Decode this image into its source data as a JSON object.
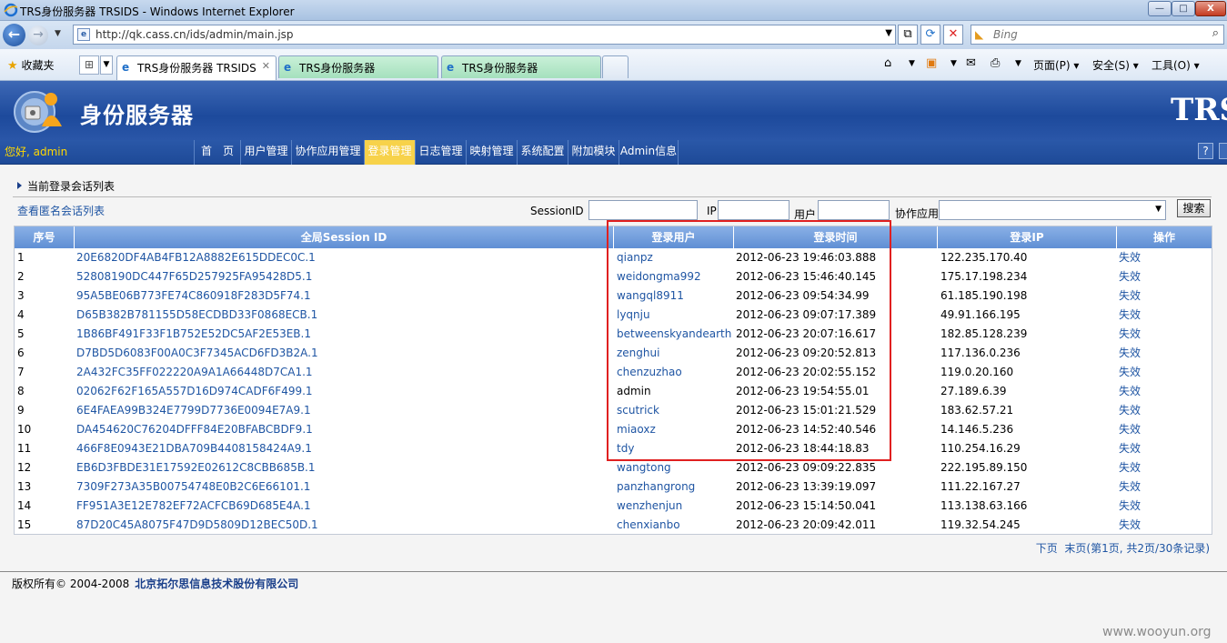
{
  "window": {
    "title": "TRS身份服务器 TRSIDS - Windows Internet Explorer",
    "buttons": {
      "minimize": "—",
      "maximize": "□",
      "close": "X"
    }
  },
  "address_bar": {
    "url": "http://qk.cass.cn/ids/admin/main.jsp",
    "search_placeholder": "Bing"
  },
  "favorites": {
    "label": "收藏夹",
    "tabs": [
      {
        "label": "TRS身份服务器 TRSIDS",
        "active": true
      },
      {
        "label": "TRS身份服务器",
        "active": false
      },
      {
        "label": "TRS身份服务器",
        "active": false
      }
    ],
    "commands": {
      "page": "页面(P)",
      "safety": "安全(S)",
      "tools": "工具(O)"
    }
  },
  "app": {
    "title": "身份服务器",
    "brand": "TRS",
    "greeting": "您好, admin",
    "menu": [
      {
        "label": "首　页"
      },
      {
        "label": "用户管理"
      },
      {
        "label": "协作应用管理"
      },
      {
        "label": "登录管理",
        "active": true
      },
      {
        "label": "日志管理"
      },
      {
        "label": "映射管理"
      },
      {
        "label": "系统配置"
      },
      {
        "label": "附加模块"
      },
      {
        "label": "Admin信息"
      }
    ],
    "help": "?"
  },
  "page": {
    "section_title": "当前登录会话列表",
    "anon_link": "查看匿名会话列表",
    "filters": {
      "session_label": "SessionID",
      "ip_label": "IP",
      "user_label": "用户",
      "app_label": "协作应用",
      "search_button": "搜索"
    },
    "table": {
      "headers": [
        "序号",
        "全局Session ID",
        "登录用户",
        "登录时间",
        "登录IP",
        "操作"
      ],
      "rows": [
        {
          "no": "1",
          "sid": "20E6820DF4AB4FB12A8882E615DDEC0C.1",
          "user": "qianpz",
          "time": "2012-06-23 19:46:03.888",
          "ip": "122.235.170.40",
          "op": "失效",
          "user_link": true
        },
        {
          "no": "2",
          "sid": "52808190DC447F65D257925FA95428D5.1",
          "user": "weidongma992",
          "time": "2012-06-23 15:46:40.145",
          "ip": "175.17.198.234",
          "op": "失效",
          "user_link": true
        },
        {
          "no": "3",
          "sid": "95A5BE06B773FE74C860918F283D5F74.1",
          "user": "wangql8911",
          "time": "2012-06-23 09:54:34.99",
          "ip": "61.185.190.198",
          "op": "失效",
          "user_link": true
        },
        {
          "no": "4",
          "sid": "D65B382B781155D58ECDBD33F0868ECB.1",
          "user": "lyqnju",
          "time": "2012-06-23 09:07:17.389",
          "ip": "49.91.166.195",
          "op": "失效",
          "user_link": true
        },
        {
          "no": "5",
          "sid": "1B86BF491F33F1B752E52DC5AF2E53EB.1",
          "user": "betweenskyandearth",
          "time": "2012-06-23 20:07:16.617",
          "ip": "182.85.128.239",
          "op": "失效",
          "user_link": true
        },
        {
          "no": "6",
          "sid": "D7BD5D6083F00A0C3F7345ACD6FD3B2A.1",
          "user": "zenghui",
          "time": "2012-06-23 09:20:52.813",
          "ip": "117.136.0.236",
          "op": "失效",
          "user_link": true
        },
        {
          "no": "7",
          "sid": "2A432FC35FF022220A9A1A66448D7CA1.1",
          "user": "chenzuzhao",
          "time": "2012-06-23 20:02:55.152",
          "ip": "119.0.20.160",
          "op": "失效",
          "user_link": true
        },
        {
          "no": "8",
          "sid": "02062F62F165A557D16D974CADF6F499.1",
          "user": "admin",
          "time": "2012-06-23 19:54:55.01",
          "ip": "27.189.6.39",
          "op": "失效",
          "user_link": false
        },
        {
          "no": "9",
          "sid": "6E4FAEA99B324E7799D7736E0094E7A9.1",
          "user": "scutrick",
          "time": "2012-06-23 15:01:21.529",
          "ip": "183.62.57.21",
          "op": "失效",
          "user_link": true
        },
        {
          "no": "10",
          "sid": "DA454620C76204DFFF84E20BFABCBDF9.1",
          "user": "miaoxz",
          "time": "2012-06-23 14:52:40.546",
          "ip": "14.146.5.236",
          "op": "失效",
          "user_link": true
        },
        {
          "no": "11",
          "sid": "466F8E0943E21DBA709B4408158424A9.1",
          "user": "tdy",
          "time": "2012-06-23 18:44:18.83",
          "ip": "110.254.16.29",
          "op": "失效",
          "user_link": true
        },
        {
          "no": "12",
          "sid": "EB6D3FBDE31E17592E02612C8CBB685B.1",
          "user": "wangtong",
          "time": "2012-06-23 09:09:22.835",
          "ip": "222.195.89.150",
          "op": "失效",
          "user_link": true
        },
        {
          "no": "13",
          "sid": "7309F273A35B00754748E0B2C6E66101.1",
          "user": "panzhangrong",
          "time": "2012-06-23 13:39:19.097",
          "ip": "111.22.167.27",
          "op": "失效",
          "user_link": true
        },
        {
          "no": "14",
          "sid": "FF951A3E12E782EF72ACFCB69D685E4A.1",
          "user": "wenzhenjun",
          "time": "2012-06-23 15:14:50.041",
          "ip": "113.138.63.166",
          "op": "失效",
          "user_link": true
        },
        {
          "no": "15",
          "sid": "87D20C45A8075F47D9D5809D12BEC50D.1",
          "user": "chenxianbo",
          "time": "2012-06-23 20:09:42.011",
          "ip": "119.32.54.245",
          "op": "失效",
          "user_link": true
        }
      ]
    },
    "pager": {
      "next": "下页",
      "last": "末页(第1页, 共2页/30条记录)"
    },
    "copyright": "版权所有© 2004-2008",
    "company": "北京拓尔思信息技术股份有限公司",
    "watermark": "www.wooyun.org"
  },
  "colors": {
    "header_blue": "#1d4a9c",
    "link": "#1f55a3",
    "active_menu": "#f7d24a",
    "highlight": "#e02020"
  }
}
